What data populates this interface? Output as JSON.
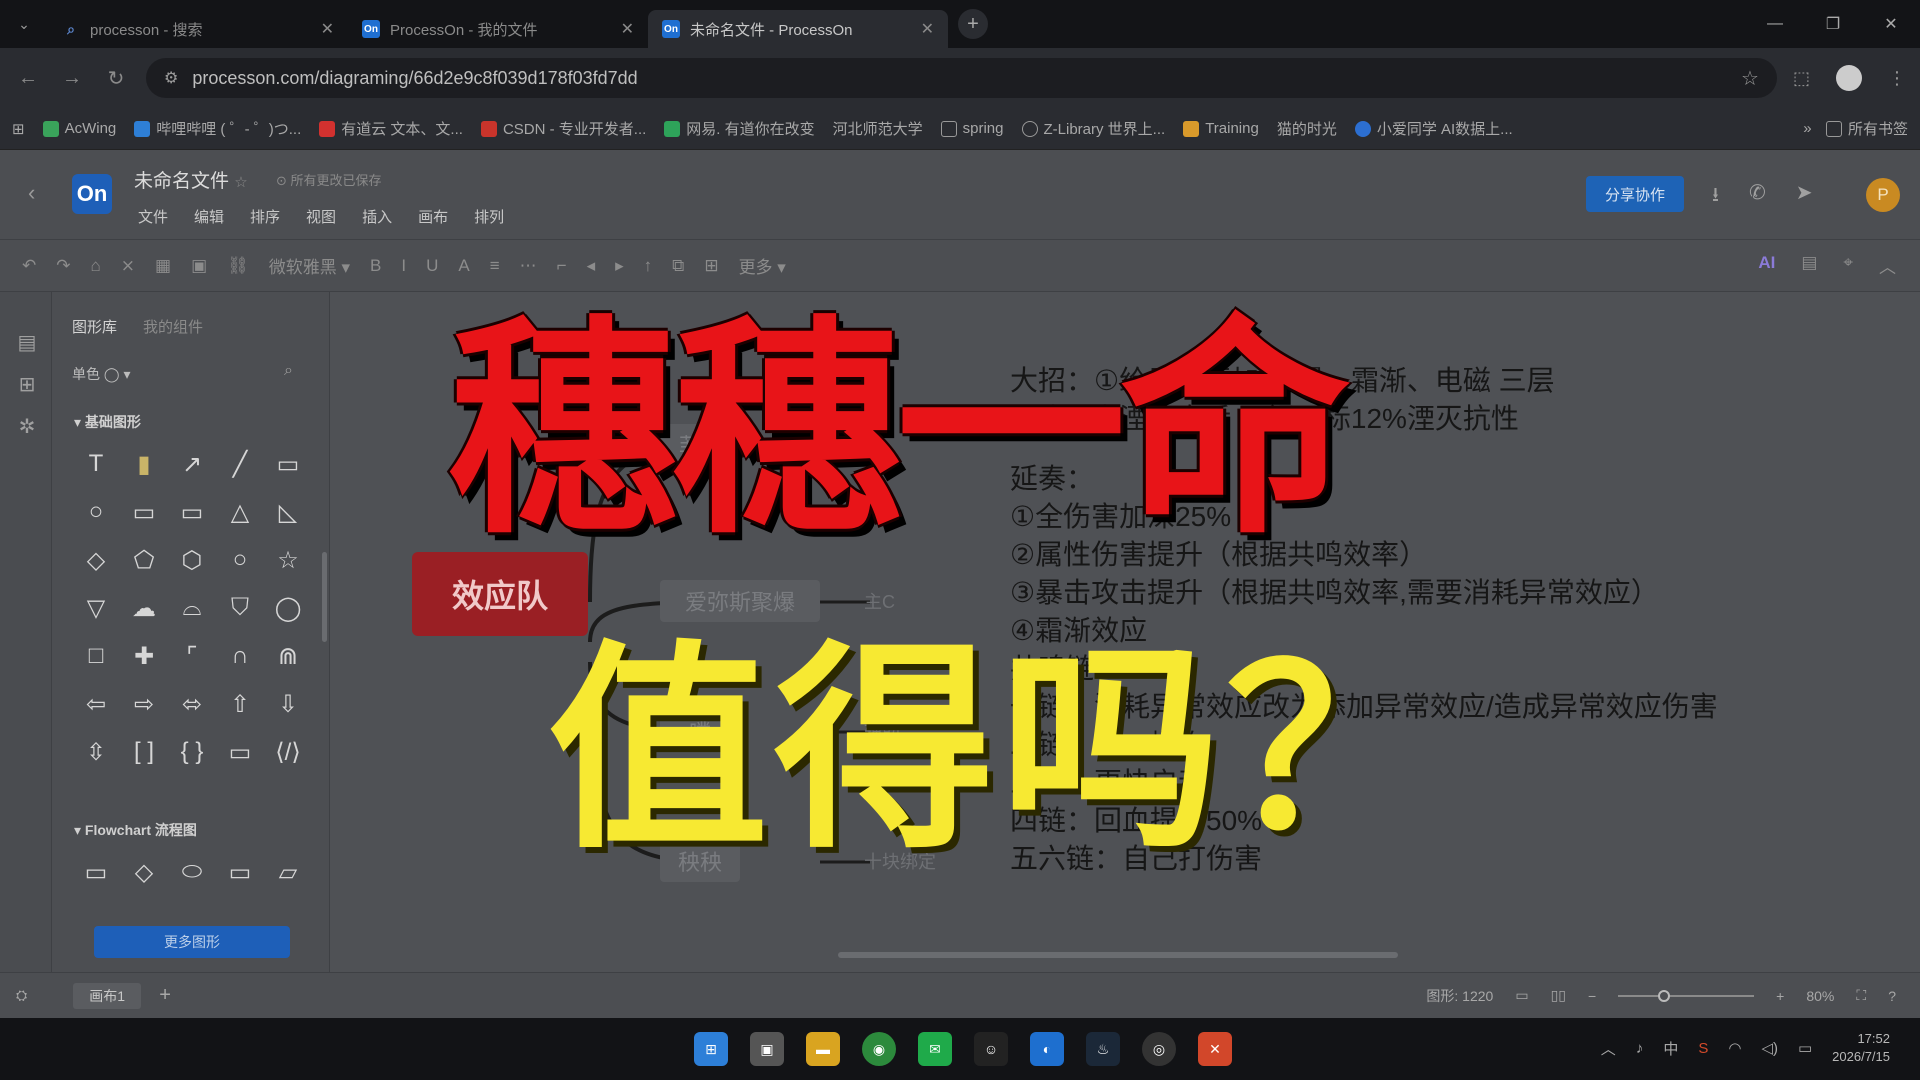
{
  "browser": {
    "tabs": [
      {
        "title": "processon - 搜索",
        "icon": "search-icon"
      },
      {
        "title": "ProcessOn - 我的文件",
        "icon": "On"
      },
      {
        "title": "未命名文件 - ProcessOn",
        "icon": "On"
      }
    ],
    "url": "processon.com/diagraming/66d2e9c8f039d178f03fd7dd",
    "bookmarks": [
      "AcWing",
      "哔哩哔哩 ( ゜- ゜)つ...",
      "有道云 文本、文...",
      "CSDN - 专业开发者...",
      "网易. 有道你在改变",
      "河北师范大学",
      "spring",
      "Z-Library 世界上...",
      "Training",
      "猫的时光",
      "小爱同学 AI数据上..."
    ],
    "bookmarks_more": "所有书签"
  },
  "app": {
    "logo": "On",
    "doc_title": "未命名文件",
    "doc_status": "所有更改已保存",
    "menu": [
      "文件",
      "编辑",
      "排序",
      "视图",
      "插入",
      "画布",
      "排列"
    ],
    "share_label": "分享协作",
    "avatar_letter": "P",
    "toolbar_font": "微软雅黑",
    "toolbar_more": "更多",
    "toolbar_ai": "AI",
    "panel_tabs": [
      "图形库",
      "我的组件"
    ],
    "panel_filter": "单色 ◯",
    "section_basic": "▾ 基础图形",
    "section_flow": "▾ Flowchart 流程图",
    "more_shapes": "更多图形",
    "page_tab": "画布1",
    "shape_count": "图形: 1220",
    "zoom": "80%"
  },
  "canvas": {
    "root_node": "效应队",
    "nodes": [
      "菲",
      "爱弥斯聚爆",
      "噗",
      "秧秧"
    ],
    "labels": [
      "主C",
      "辅助",
      "主C",
      "十块绑定"
    ],
    "note_lines": [
      "大招：①给目标添加 聚爆、霜渐、电磁 三层",
      "②消耗虚湮效应后 无视目标12%湮灭抗性",
      "",
      "延奏：",
      "①全伤害加深25%",
      "②属性伤害提升（根据共鸣效率）",
      "③暴击攻击提升（根据共鸣效率,需要消耗异常效应）",
      "④霜渐效应",
      "共鸣链：",
      "一链：消耗异常效应改为添加异常效应/造成异常效应伤害",
      "二链：50%爆伤",
      "三链：更快启动",
      "四链：回血提高50%",
      "五六链：自己打伤害"
    ]
  },
  "overlay": {
    "line1": "穗穗一命",
    "line2": "值得吗？"
  },
  "taskbar": {
    "time": "17:52",
    "date": "2026/7/15",
    "ime": "中"
  }
}
